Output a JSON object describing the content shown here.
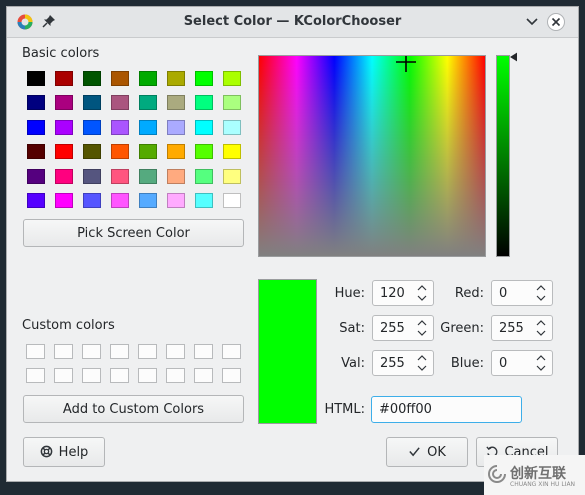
{
  "window": {
    "title": "Select Color — KColorChooser"
  },
  "basic_colors": {
    "label": "Basic colors",
    "rows": [
      [
        "#000000",
        "#aa0000",
        "#005500",
        "#aa5500",
        "#00aa00",
        "#aaaa00",
        "#00ff00",
        "#aaff00"
      ],
      [
        "#00007f",
        "#aa007f",
        "#00557f",
        "#aa557f",
        "#00aa7f",
        "#aaaa7f",
        "#00ff7f",
        "#aaff7f"
      ],
      [
        "#0000ff",
        "#aa00ff",
        "#0055ff",
        "#aa55ff",
        "#00aaff",
        "#aaaaff",
        "#00ffff",
        "#aaffff"
      ],
      [
        "#550000",
        "#ff0000",
        "#555500",
        "#ff5500",
        "#55aa00",
        "#ffaa00",
        "#55ff00",
        "#ffff00"
      ],
      [
        "#55007f",
        "#ff007f",
        "#55557f",
        "#ff557f",
        "#55aa7f",
        "#ffaa7f",
        "#55ff7f",
        "#ffff7f"
      ],
      [
        "#5500ff",
        "#ff00ff",
        "#5555ff",
        "#ff55ff",
        "#55aaff",
        "#ffaaff",
        "#55ffff",
        "#ffffff"
      ]
    ]
  },
  "pick_screen_button": "Pick Screen Color",
  "custom_colors": {
    "label": "Custom colors"
  },
  "add_custom_button": "Add to Custom Colors",
  "current_color": "#00ff00",
  "fields": {
    "hue": {
      "label": "Hue:",
      "value": "120"
    },
    "sat": {
      "label": "Sat:",
      "value": "255"
    },
    "val": {
      "label": "Val:",
      "value": "255"
    },
    "red": {
      "label": "Red:",
      "value": "0"
    },
    "green": {
      "label": "Green:",
      "value": "255"
    },
    "blue": {
      "label": "Blue:",
      "value": "0"
    },
    "html": {
      "label": "HTML:",
      "value": "#00ff00"
    }
  },
  "buttons": {
    "help": "Help",
    "ok": "OK",
    "cancel": "Cancel"
  },
  "watermark": {
    "main": "创新互联",
    "sub": "CHUANG XIN HU LIAN"
  }
}
